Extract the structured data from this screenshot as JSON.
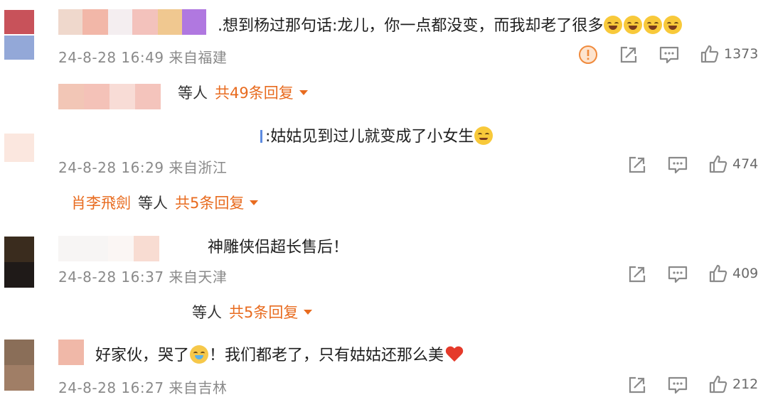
{
  "comments": [
    {
      "text": ".想到杨过那句话:龙儿，你一点都没变，而我却老了很多",
      "time": "24-8-28 16:49",
      "location": "来自福建",
      "likes": "1373",
      "replies": {
        "names": "等人",
        "count": "共49条回复"
      }
    },
    {
      "text": ":姑姑见到过儿就变成了小女生",
      "time": "24-8-28 16:29",
      "location": "来自浙江",
      "likes": "474",
      "replies": {
        "names_highlight": "肖李飛劍",
        "names": "等人",
        "count": "共5条回复"
      }
    },
    {
      "text": "神雕侠侣超长售后！",
      "time": "24-8-28 16:37",
      "location": "来自天津",
      "likes": "409",
      "replies": {
        "names": "等人",
        "count": "共5条回复"
      }
    },
    {
      "text_a": "好家伙，哭了",
      "text_b": "！我们都老了，只有姑姑还那么美",
      "time": "24-8-28 16:27",
      "location": "来自吉林",
      "likes": "212"
    }
  ],
  "icons": {
    "report": "warning-circle-icon",
    "share": "share-icon",
    "comment": "comment-icon",
    "like": "thumbs-up-icon"
  },
  "colors": {
    "accent": "#e86b1f",
    "meta": "#8a8a8a"
  }
}
